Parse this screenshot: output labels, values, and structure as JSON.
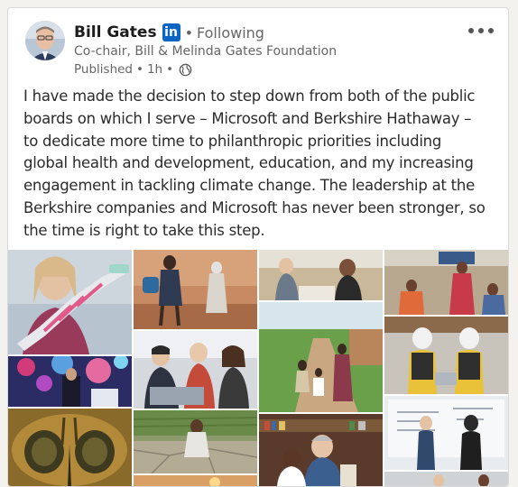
{
  "author": {
    "name": "Bill Gates",
    "badge": "in",
    "relationship": "Following",
    "headline": "Co-chair, Bill & Melinda Gates Foundation"
  },
  "meta": {
    "status": "Published",
    "age": "1h",
    "visibility_icon": "globe-icon"
  },
  "menu_icon": "more-horizontal-icon",
  "post": {
    "lines": [
      "I have made the decision to step down from both of the public",
      "boards on which I serve – Microsoft and Berkshire Hathaway –",
      "to dedicate more time to philanthropic priorities including",
      "global health and development, education, and my increasing",
      "engagement in tackling climate change. The leadership at the",
      "Berkshire companies and Microsoft has never been stronger, so",
      "the time is right to take this step."
    ]
  },
  "colors": {
    "linkedin_blue": "#0a66c2",
    "muted_text": "#666666",
    "body_text": "#2b2b2b"
  }
}
